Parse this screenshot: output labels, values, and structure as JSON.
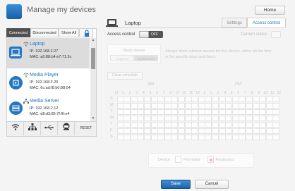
{
  "header": {
    "title": "Manage my devices",
    "home_label": "Home"
  },
  "filters": {
    "tabs": [
      "Connected",
      "Disconnected",
      "Show All"
    ],
    "active": "Connected"
  },
  "devices": [
    {
      "name": "Laptop",
      "ip": "IP: 192.168.2.27",
      "mac": "MAC: a0:88:b4:e7:71:3c",
      "icon": "laptop-icon",
      "connection": "wifi"
    },
    {
      "name": "Media Player",
      "ip": "IP: 192.168.2.20",
      "mac": "MAC: 6c:ad:f8:b0:88:04",
      "icon": "media-player-icon",
      "connection": "wifi"
    },
    {
      "name": "Media Server",
      "ip": "IP: 192.168.2.12",
      "mac": "MAC: d8:d3:85:7f:f6:e4",
      "icon": "media-server-icon",
      "connection": "wired"
    }
  ],
  "toolbar": {
    "reset_label": "RESET",
    "icons": [
      "wifi-filter-icon",
      "ethernet-filter-icon",
      "usb-filter-icon",
      "adapter-filter-icon"
    ]
  },
  "detail": {
    "device_name": "Laptop",
    "tabs": [
      "Settings",
      "Access control"
    ],
    "active_tab": "Access control",
    "access_control_label": "Access control",
    "toggle_state": "OFF",
    "current_status_label": "Current status",
    "block_device_label": "Block device",
    "block_modes": [
      "ALWAYS",
      "SCHEDULE"
    ],
    "block_mode_selected": "SCHEDULE",
    "block_description": "Always block internet access for this device, either all the time or for specific days and times.",
    "clear_schedule_label": "Clear schedule",
    "am_label": "AM",
    "pm_label": "PM",
    "hours": [
      "12",
      "1",
      "2",
      "3",
      "4",
      "5",
      "6",
      "7",
      "8",
      "9",
      "10",
      "11",
      "12",
      "1",
      "2",
      "3",
      "4",
      "5",
      "6",
      "7",
      "8",
      "9",
      "10",
      "11",
      "12"
    ],
    "days": [
      "S",
      "M",
      "T",
      "W",
      "T",
      "F",
      "S"
    ],
    "legend": {
      "device_label": "Device",
      "permitted_label": "Permitted",
      "restricted_label": "Restricted"
    }
  },
  "actions": {
    "save_label": "Save",
    "cancel_label": "Cancel"
  },
  "colors": {
    "accent": "#2477c3",
    "toggle_off": "#555555",
    "selected_row": "#dcdcdc"
  }
}
